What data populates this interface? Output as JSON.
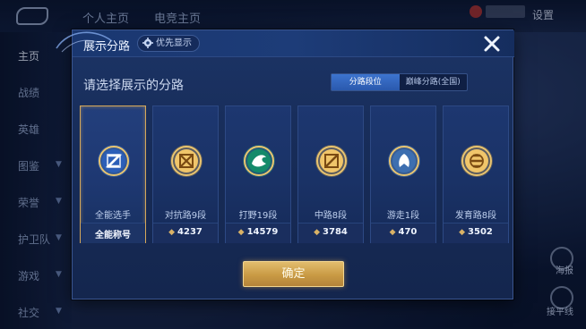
{
  "topbar": {
    "tabs": [
      "个人主页",
      "电竞主页"
    ],
    "settings_label": "设置"
  },
  "sidebar": {
    "items": [
      {
        "label": "主页",
        "active": true,
        "arrow": false
      },
      {
        "label": "战绩",
        "active": false,
        "arrow": false
      },
      {
        "label": "英雄",
        "active": false,
        "arrow": false
      },
      {
        "label": "图鉴",
        "active": false,
        "arrow": true
      },
      {
        "label": "荣誉",
        "active": false,
        "arrow": true
      },
      {
        "label": "护卫队",
        "active": false,
        "arrow": true
      },
      {
        "label": "游戏",
        "active": false,
        "arrow": true
      },
      {
        "label": "社交",
        "active": false,
        "arrow": true
      }
    ]
  },
  "right_panel": {
    "labels": [
      "海报",
      "接平线"
    ]
  },
  "modal": {
    "title": "展示分路",
    "priority_label": "优先显示",
    "prompt": "请选择展示的分路",
    "toggle": {
      "options": [
        "分路段位",
        "巅峰分路(全国)"
      ],
      "selected_index": 0
    },
    "confirm_label": "确定"
  },
  "lanes": [
    {
      "name": "全能选手",
      "footer_type": "title",
      "footer": "全能称号",
      "selected": true,
      "icon": "all-round-badge-icon",
      "color": "#4f8fe0"
    },
    {
      "name": "对抗路9段",
      "footer_type": "points",
      "footer": "4237",
      "selected": false,
      "icon": "clash-lane-badge-icon",
      "color": "#d8a94c"
    },
    {
      "name": "打野19段",
      "footer_type": "points",
      "footer": "14579",
      "selected": false,
      "icon": "jungle-badge-icon",
      "color": "#2fb08c"
    },
    {
      "name": "中路8段",
      "footer_type": "points",
      "footer": "3784",
      "selected": false,
      "icon": "mid-lane-badge-icon",
      "color": "#d8a94c"
    },
    {
      "name": "游走1段",
      "footer_type": "points",
      "footer": "470",
      "selected": false,
      "icon": "roam-badge-icon",
      "color": "#6fa8e0"
    },
    {
      "name": "发育路8段",
      "footer_type": "points",
      "footer": "3502",
      "selected": false,
      "icon": "farm-lane-badge-icon",
      "color": "#d8a94c"
    }
  ],
  "colors": {
    "accent_gold": "#d9b266",
    "selected_border": "#d6a85a",
    "toggle_active": "#3d74cf"
  }
}
